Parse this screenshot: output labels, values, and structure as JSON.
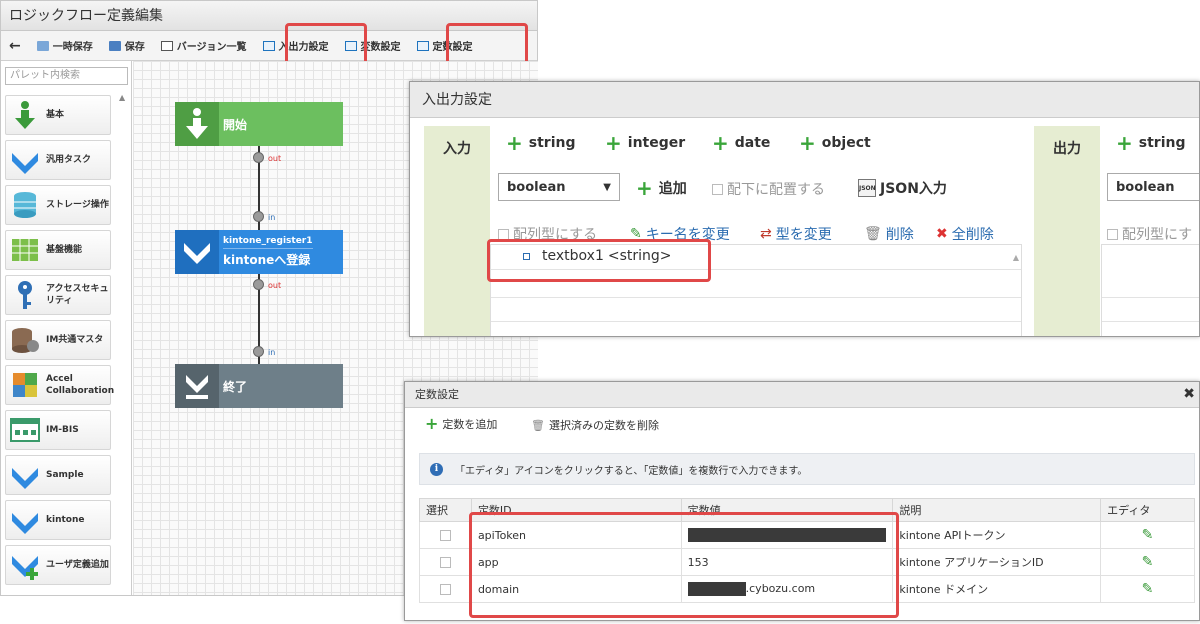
{
  "editor": {
    "title": "ロジックフロー定義編集",
    "toolbar": {
      "back": "←",
      "temp_save": "一時保存",
      "save": "保存",
      "version_list": "バージョン一覧",
      "io_settings": "入出力設定",
      "var_settings": "変数設定",
      "const_settings": "定数設定"
    },
    "palette": {
      "search_placeholder": "パレット内検索",
      "items": [
        {
          "label": "基本",
          "icon": "down-arrow-icon"
        },
        {
          "label": "汎用タスク",
          "icon": "blue-arrow-icon"
        },
        {
          "label": "ストレージ操作",
          "icon": "storage-icon"
        },
        {
          "label": "基盤機能",
          "icon": "grid-icon"
        },
        {
          "label": "アクセスセキュリティ",
          "icon": "key-icon"
        },
        {
          "label": "IM共通マスタ",
          "icon": "database-icon"
        },
        {
          "label": "Accel Collaboration",
          "icon": "collaboration-icon"
        },
        {
          "label": "IM-BIS",
          "icon": "bis-icon"
        },
        {
          "label": "Sample",
          "icon": "blue-arrow-icon"
        },
        {
          "label": "kintone",
          "icon": "blue-arrow-icon"
        },
        {
          "label": "ユーザ定義追加",
          "icon": "user-add-icon"
        }
      ]
    },
    "flow": {
      "start": "開始",
      "out1": "out",
      "in1": "in",
      "task_name": "kintone_register1",
      "task_label": "kintoneへ登録",
      "out2": "out",
      "in2": "in",
      "end": "終了"
    }
  },
  "io_panel": {
    "title": "入出力設定",
    "input_label": "入力",
    "output_label": "出力",
    "type_buttons": [
      "string",
      "integer",
      "date",
      "object"
    ],
    "output_type_button": "string",
    "type_select": "boolean",
    "output_type_select": "boolean",
    "add": "追加",
    "place_under": "配下に配置する",
    "json_input": "JSON入力",
    "array_type": "配列型にする",
    "array_type_out": "配列型にす",
    "rename_key": "キー名を変更",
    "change_type": "型を変更",
    "delete": "削除",
    "delete_all": "全削除",
    "items": [
      {
        "name": "textbox1",
        "type": "<string>"
      }
    ]
  },
  "const_panel": {
    "title": "定数設定",
    "add": "定数を追加",
    "delete_selected": "選択済みの定数を削除",
    "info": "「エディタ」アイコンをクリックすると、「定数値」を複数行で入力できます。",
    "columns": [
      "選択",
      "定数ID",
      "定数値",
      "説明",
      "エディタ"
    ],
    "rows": [
      {
        "id": "apiToken",
        "value": "",
        "desc": "kintone APIトークン"
      },
      {
        "id": "app",
        "value": "153",
        "desc": "kintone アプリケーションID"
      },
      {
        "id": "domain",
        "value": ".cybozu.com",
        "desc": "kintone ドメイン"
      }
    ],
    "masked": [
      {
        "row": 0,
        "fraction": 1.0
      },
      {
        "row": 2,
        "fraction": 0.3
      }
    ]
  },
  "colors": {
    "start": "#6cbf5f",
    "task": "#2f8ae0",
    "end": "#6e7f89",
    "highlight": "#e04848",
    "io_column": "#e6edd2"
  }
}
